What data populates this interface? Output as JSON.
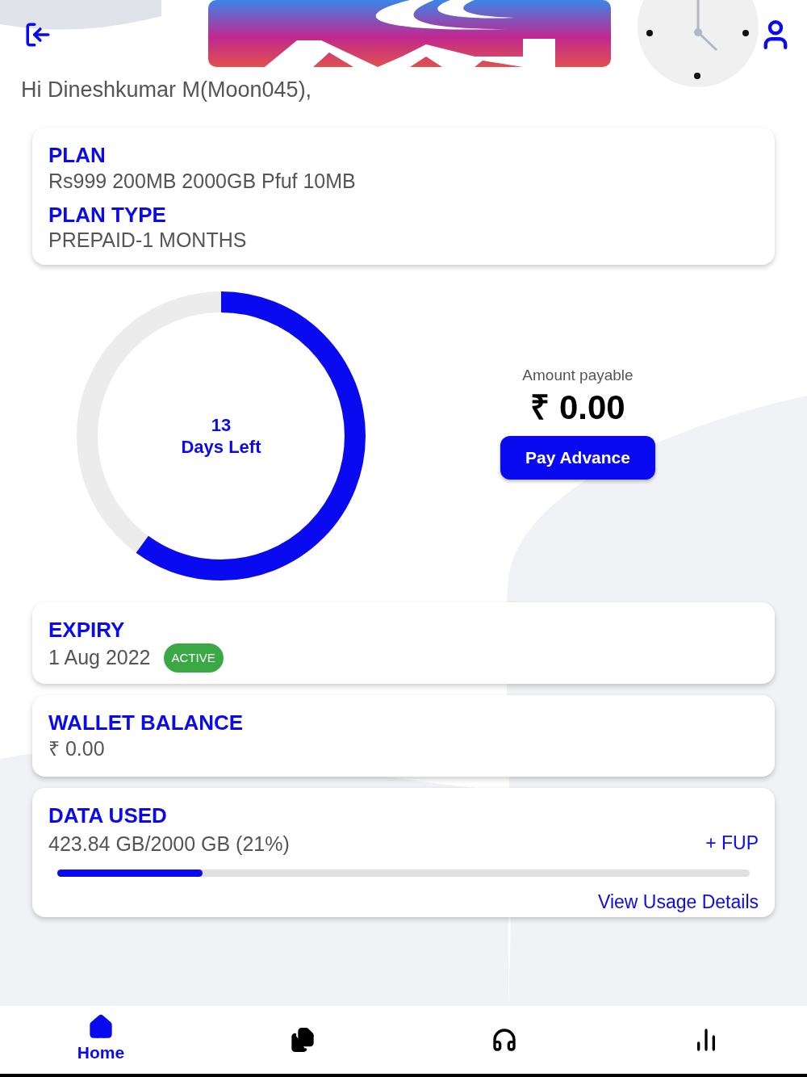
{
  "greeting": "Hi Dineshkumar M(Moon045),",
  "plan": {
    "plan_label": "PLAN",
    "plan_value": "Rs999 200MB 2000GB Pfuf 10MB",
    "type_label": "PLAN TYPE",
    "type_value": "PREPAID-1 MONTHS"
  },
  "days": {
    "count": "13",
    "label": "Days Left",
    "level": 0.6
  },
  "payment": {
    "label": "Amount payable",
    "amount": "₹ 0.00",
    "button": "Pay Advance"
  },
  "expiry": {
    "label": "EXPIRY",
    "date": "1 Aug 2022",
    "status": "ACTIVE",
    "active": true
  },
  "wallet": {
    "label": "WALLET BALANCE",
    "amount": "₹ 0.00"
  },
  "data_used": {
    "label": "DATA USED",
    "usage": "423.84 GB/2000 GB (21%)",
    "fup": "+ FUP",
    "level": 0.21,
    "link": "View Usage Details"
  },
  "nav": [
    {
      "kind": "home",
      "label": "Home",
      "selected": true
    },
    {
      "kind": "documents",
      "selected": false
    },
    {
      "kind": "support",
      "selected": false
    },
    {
      "kind": "stats",
      "selected": false
    }
  ]
}
